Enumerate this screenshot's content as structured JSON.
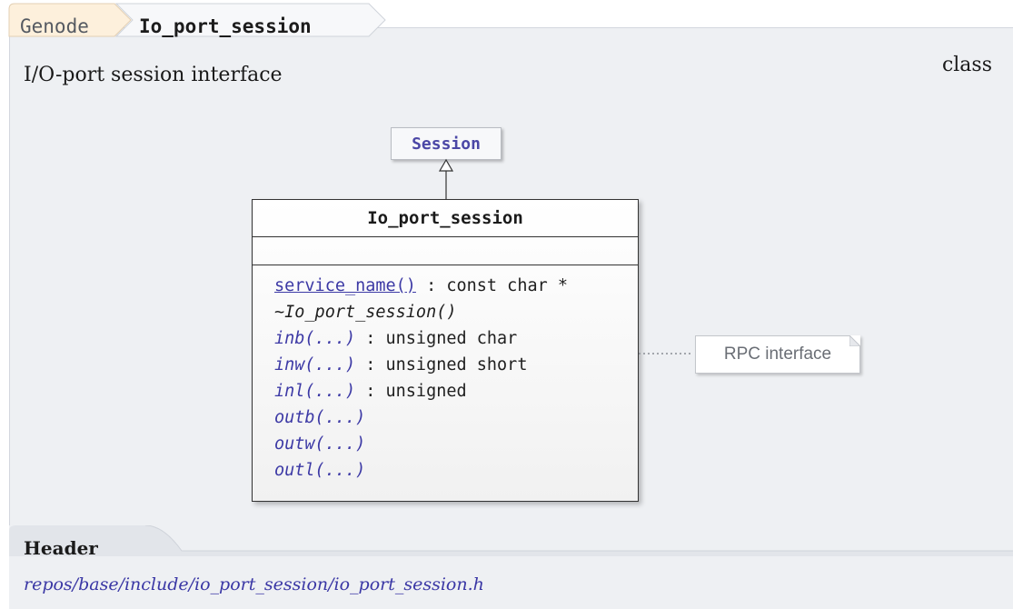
{
  "breadcrumb": {
    "parent": "Genode",
    "current": "Io_port_session"
  },
  "subtitle": "I/O-port session interface",
  "kind": "class",
  "diagram": {
    "superclass": "Session",
    "class_name": "Io_port_session",
    "operations": [
      {
        "name": "service_name()",
        "suffix": " : const char *",
        "style": "link"
      },
      {
        "name": "~Io_port_session()",
        "suffix": "",
        "style": "dtor"
      },
      {
        "name": "inb(...)",
        "suffix": " : unsigned char",
        "style": "italic"
      },
      {
        "name": "inw(...)",
        "suffix": " : unsigned short",
        "style": "italic"
      },
      {
        "name": "inl(...)",
        "suffix": " : unsigned",
        "style": "italic"
      },
      {
        "name": "outb(...)",
        "suffix": "",
        "style": "italic"
      },
      {
        "name": "outw(...)",
        "suffix": "",
        "style": "italic"
      },
      {
        "name": "outl(...)",
        "suffix": "",
        "style": "italic"
      }
    ],
    "note": "RPC interface"
  },
  "header": {
    "label": "Header",
    "path": "repos/base/include/io_port_session/io_port_session.h"
  }
}
